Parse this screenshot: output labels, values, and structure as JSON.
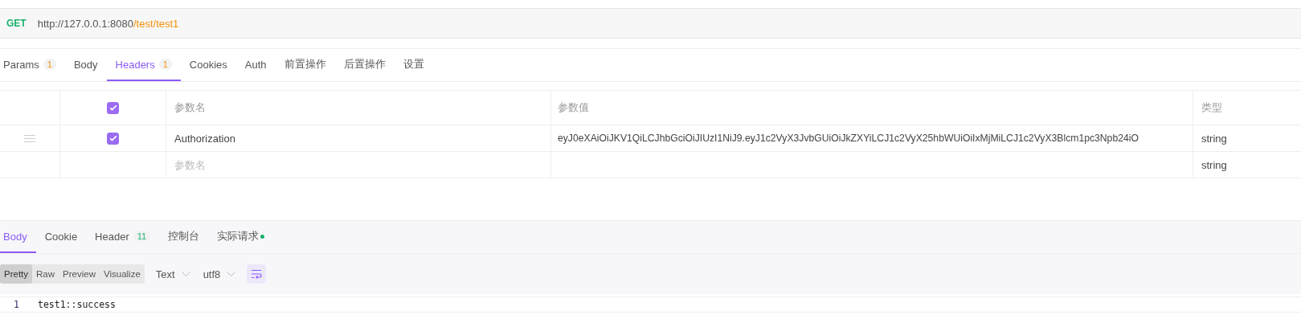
{
  "request": {
    "method": "GET",
    "url_base": "http://127.0.0.1:8080",
    "url_path": "/test/test1"
  },
  "request_tabs": [
    {
      "label": "Params",
      "badge": "1",
      "selected": false
    },
    {
      "label": "Body",
      "selected": false
    },
    {
      "label": "Headers",
      "badge": "1",
      "selected": true
    },
    {
      "label": "Cookies",
      "selected": false
    },
    {
      "label": "Auth",
      "selected": false
    },
    {
      "label": "前置操作",
      "selected": false
    },
    {
      "label": "后置操作",
      "selected": false
    },
    {
      "label": "设置",
      "selected": false
    }
  ],
  "headers_table": {
    "all_checked": true,
    "columns": [
      "参数名",
      "参数值",
      "类型"
    ],
    "rows": [
      {
        "checked": true,
        "name": "Authorization",
        "value": "eyJ0eXAiOiJKV1QiLCJhbGciOiJIUzI1NiJ9.eyJ1c2VyX3JvbGUiOiJkZXYiLCJ1c2VyX25hbWUiOiIxMjMiLCJ1c2VyX3Blcm1pc3Npb24iO",
        "type": "string"
      }
    ],
    "new_row": {
      "name_placeholder": "参数名",
      "type": "string"
    }
  },
  "response_tabs": [
    {
      "label": "Body",
      "selected": true
    },
    {
      "label": "Cookie",
      "selected": false
    },
    {
      "label": "Header",
      "badge": "11",
      "selected": false
    },
    {
      "label": "控制台",
      "selected": false
    },
    {
      "label": "实际请求",
      "dot": true,
      "selected": false
    }
  ],
  "view_modes": [
    {
      "label": "Pretty",
      "selected": true
    },
    {
      "label": "Raw",
      "selected": false
    },
    {
      "label": "Preview",
      "selected": false
    },
    {
      "label": "Visualize",
      "selected": false
    }
  ],
  "format_select": "Text",
  "encoding_select": "utf8",
  "code_lines": [
    {
      "number": "1",
      "text": "test1::success"
    }
  ]
}
